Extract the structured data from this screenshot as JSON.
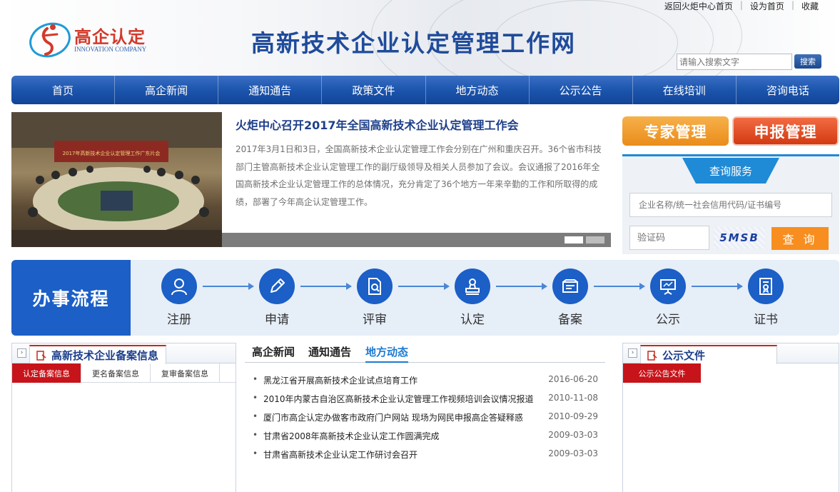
{
  "header": {
    "top_links": [
      "返回火炬中心首页",
      "设为首页",
      "收藏"
    ],
    "logo_cn": "高企认定",
    "logo_en": "INNOVATION COMPANY",
    "site_title": "高新技术企业认定管理工作网",
    "search_placeholder": "请输入搜索文字",
    "search_button": "搜索"
  },
  "nav": [
    "首页",
    "高企新闻",
    "通知通告",
    "政策文件",
    "地方动态",
    "公示公告",
    "在线培训",
    "咨询电话"
  ],
  "slide": {
    "photo_banner": "2017年高新技术企业认定管理工作广东片会",
    "title": "火炬中心召开2017年全国高新技术企业认定管理工作会",
    "body": "2017年3月1日和3日，全国高新技术企业认定管理工作会分别在广州和重庆召开。36个省市科技部门主管高新技术企业认定管理工作的副厅级领导及相关人员参加了会议。会议通报了2016年全国高新技术企业认定管理工作的总体情况，充分肯定了36个地方一年来辛勤的工作和所取得的成绩，部署了今年高企认定管理工作。"
  },
  "query": {
    "expert_button": "专家管理",
    "apply_button": "申报管理",
    "tab_label": "查询服务",
    "enterprise_placeholder": "企业名称/统一社会信用代码/证书编号",
    "captcha_placeholder": "验证码",
    "captcha_text": "5MSB",
    "query_button": "查 询"
  },
  "process": {
    "label": "办事流程",
    "steps": [
      {
        "label": "注册",
        "icon": "user-icon"
      },
      {
        "label": "申请",
        "icon": "pencil-icon"
      },
      {
        "label": "评审",
        "icon": "document-search-icon"
      },
      {
        "label": "认定",
        "icon": "stamp-icon"
      },
      {
        "label": "备案",
        "icon": "folder-icon"
      },
      {
        "label": "公示",
        "icon": "presentation-icon"
      },
      {
        "label": "证书",
        "icon": "certificate-icon"
      }
    ]
  },
  "record_box": {
    "title": "高新技术企业备案信息",
    "tabs": [
      "认定备案信息",
      "更名备案信息",
      "复审备案信息"
    ]
  },
  "news_list": {
    "tabs": [
      "高企新闻",
      "通知通告",
      "地方动态"
    ],
    "active_tab": "地方动态",
    "items": [
      {
        "title": "黑龙江省开展高新技术企业试点培育工作",
        "date": "2016-06-20"
      },
      {
        "title": "2010年内蒙古自治区高新技术企业认定管理工作视频培训会议情况报道",
        "date": "2010-11-08"
      },
      {
        "title": "厦门市高企认定办做客市政府门户网站 现场为网民申报高企答疑释惑",
        "date": "2010-09-29"
      },
      {
        "title": "甘肃省2008年高新技术企业认定工作圆满完成",
        "date": "2009-03-03"
      },
      {
        "title": "甘肃省高新技术企业认定工作研讨会召开",
        "date": "2009-03-03"
      }
    ]
  },
  "notice_box": {
    "title": "公示文件",
    "tabs": [
      "公示公告文件"
    ]
  },
  "colors": {
    "brand_blue": "#1b5fc7",
    "nav_blue": "#1c55ad",
    "accent_red": "#c7141a",
    "accent_orange": "#f78e1f"
  }
}
